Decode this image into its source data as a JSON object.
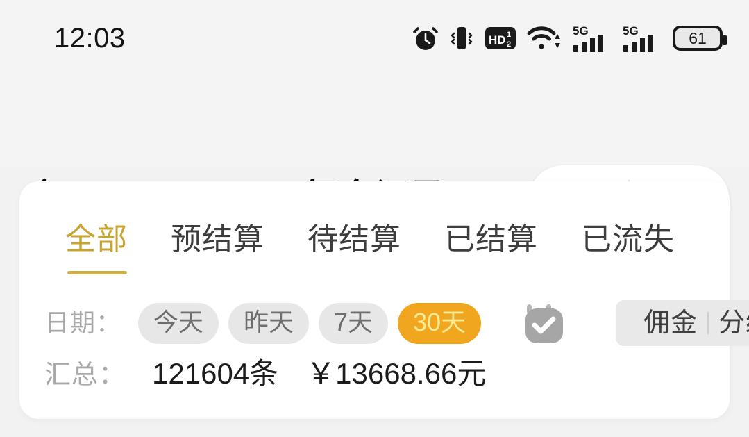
{
  "status_bar": {
    "clock": "12:03",
    "battery_level": "61",
    "icons": [
      "alarm-icon",
      "vibrate-icon",
      "hd-volte-icon",
      "wifi-icon",
      "signal-5g-icon",
      "signal-5g-icon",
      "battery-icon"
    ]
  },
  "header": {
    "title": "佣金记录",
    "back_icon": "chevron-left-icon",
    "capsule": {
      "menu_icon": "more-dots-icon",
      "target_icon": "target-icon"
    }
  },
  "tabs": [
    {
      "label": "全部",
      "active": true
    },
    {
      "label": "预结算",
      "active": false
    },
    {
      "label": "待结算",
      "active": false
    },
    {
      "label": "已结算",
      "active": false
    },
    {
      "label": "已流失",
      "active": false
    }
  ],
  "filter": {
    "label": "日期：",
    "chips": [
      {
        "label": "今天",
        "active": false
      },
      {
        "label": "昨天",
        "active": false
      },
      {
        "label": "7天",
        "active": false
      },
      {
        "label": "30天",
        "active": true
      }
    ],
    "calendar_icon": "calendar-check-icon",
    "segments": [
      {
        "label": "佣金"
      },
      {
        "label": "分红"
      }
    ]
  },
  "summary": {
    "label": "汇总：",
    "count": "121604条",
    "amount": "￥13668.66元"
  },
  "colors": {
    "page_bg": "#f2f2f2",
    "card_bg": "#ffffff",
    "accent_gold": "#c6a42f",
    "accent_orange": "#f0a61e",
    "chip_active_text": "#fbeb95",
    "chip_bg": "#e7e7e7",
    "muted_text": "#a9a9a9"
  }
}
